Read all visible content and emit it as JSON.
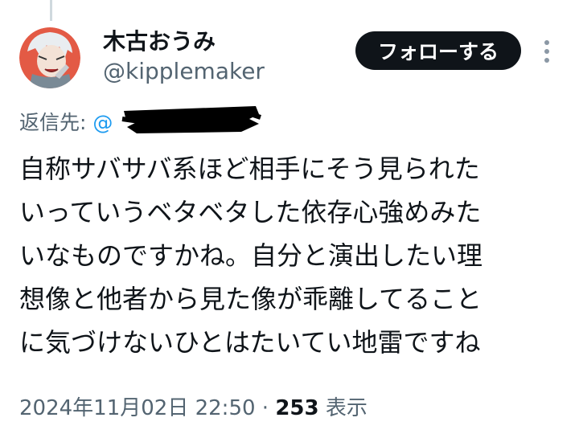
{
  "tweet": {
    "author": {
      "display_name": "木古おうみ",
      "handle": "@kipplemaker",
      "avatar_icon": "avatar-illustration"
    },
    "follow_label": "フォローする",
    "more_icon": "more-vertical-icon",
    "reply_to": {
      "label": "返信先:",
      "mention_visible": "@"
    },
    "text_lines": [
      "自称サバサバ系ほど相手にそう見られた",
      "いっていうベタベタした依存心強めみた",
      "いなものですかね。自分と演出したい理",
      "想像と他者から見た像が乖離してること",
      "に気づけないひとはたいてい地雷ですね"
    ],
    "timestamp": "2024年11月02日 22:50",
    "separator": "·",
    "views_count": "253",
    "views_label": "表示"
  },
  "colors": {
    "text": "#0f1419",
    "secondary": "#536471",
    "link": "#1d9bf0",
    "button_bg": "#0f1419",
    "thread_line": "#cfd9de"
  }
}
